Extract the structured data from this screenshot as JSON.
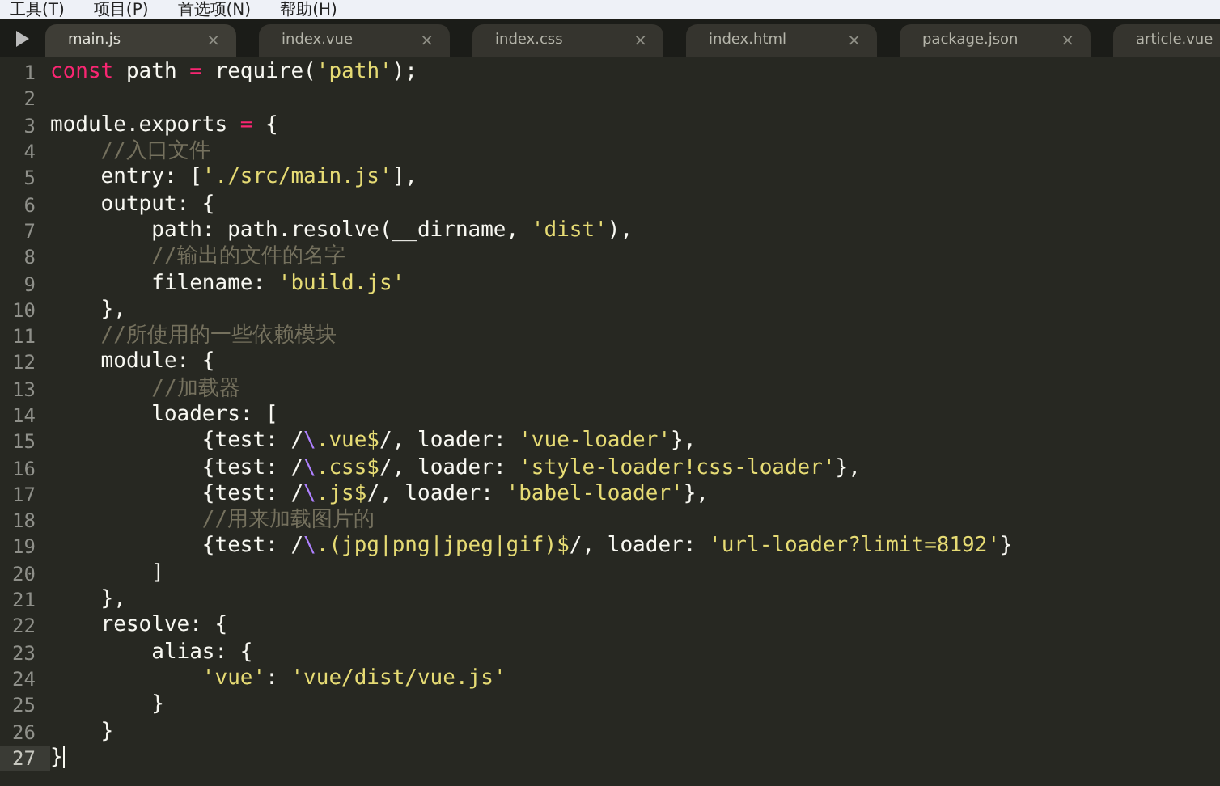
{
  "menu": [
    {
      "label": "工具(T)"
    },
    {
      "label": "项目(P)"
    },
    {
      "label": "首选项(N)"
    },
    {
      "label": "帮助(H)"
    }
  ],
  "tabs": [
    {
      "label": "main.js",
      "selected": true
    },
    {
      "label": "index.vue",
      "selected": false
    },
    {
      "label": "index.css",
      "selected": false
    },
    {
      "label": "index.html",
      "selected": false
    },
    {
      "label": "package.json",
      "selected": false
    },
    {
      "label": "article.vue",
      "selected": false
    }
  ],
  "close_glyph": "×",
  "lines": [
    {
      "number": "1",
      "current": false,
      "segments": [
        {
          "kind": "keyword",
          "text": "const"
        },
        {
          "kind": "plain",
          "text": " path "
        },
        {
          "kind": "keyword",
          "text": "="
        },
        {
          "kind": "plain",
          "text": " require("
        },
        {
          "kind": "string",
          "text": "'path'"
        },
        {
          "kind": "plain",
          "text": ");"
        }
      ]
    },
    {
      "number": "2",
      "current": false
    },
    {
      "number": "3",
      "current": false,
      "segments": [
        {
          "kind": "plain",
          "text": "module.exports "
        },
        {
          "kind": "keyword",
          "text": "="
        },
        {
          "kind": "plain",
          "text": " {"
        }
      ]
    },
    {
      "number": "4",
      "current": false,
      "segments": [
        {
          "kind": "comment",
          "text": "    //入口文件"
        }
      ]
    },
    {
      "number": "5",
      "current": false,
      "segments": [
        {
          "kind": "plain",
          "text": "    entry: ["
        },
        {
          "kind": "string",
          "text": "'./src/main.js'"
        },
        {
          "kind": "plain",
          "text": "],"
        }
      ]
    },
    {
      "number": "6",
      "current": false,
      "segments": [
        {
          "kind": "plain",
          "text": "    output: {"
        }
      ]
    },
    {
      "number": "7",
      "current": false,
      "segments": [
        {
          "kind": "plain",
          "text": "        path: path.resolve(__dirname, "
        },
        {
          "kind": "string",
          "text": "'dist'"
        },
        {
          "kind": "plain",
          "text": "),"
        }
      ]
    },
    {
      "number": "8",
      "current": false,
      "segments": [
        {
          "kind": "comment",
          "text": "        //输出的文件的名字"
        }
      ]
    },
    {
      "number": "9",
      "current": false,
      "segments": [
        {
          "kind": "plain",
          "text": "        filename: "
        },
        {
          "kind": "string",
          "text": "'build.js'"
        }
      ]
    },
    {
      "number": "10",
      "current": false,
      "segments": [
        {
          "kind": "plain",
          "text": "    },"
        }
      ]
    },
    {
      "number": "11",
      "current": false,
      "segments": [
        {
          "kind": "comment",
          "text": "    //所使用的一些依赖模块"
        }
      ]
    },
    {
      "number": "12",
      "current": false,
      "segments": [
        {
          "kind": "plain",
          "text": "    module: {"
        }
      ]
    },
    {
      "number": "13",
      "current": false,
      "segments": [
        {
          "kind": "comment",
          "text": "        //加载器"
        }
      ]
    },
    {
      "number": "14",
      "current": false,
      "segments": [
        {
          "kind": "plain",
          "text": "        loaders: ["
        }
      ]
    },
    {
      "number": "15",
      "current": false,
      "segments": [
        {
          "kind": "plain",
          "text": "            {test: /"
        },
        {
          "kind": "escape",
          "text": "\\"
        },
        {
          "kind": "string",
          "text": ".vue$"
        },
        {
          "kind": "plain",
          "text": "/, loader: "
        },
        {
          "kind": "string",
          "text": "'vue-loader'"
        },
        {
          "kind": "plain",
          "text": "},"
        }
      ]
    },
    {
      "number": "16",
      "current": false,
      "segments": [
        {
          "kind": "plain",
          "text": "            {test: /"
        },
        {
          "kind": "escape",
          "text": "\\"
        },
        {
          "kind": "string",
          "text": ".css$"
        },
        {
          "kind": "plain",
          "text": "/, loader: "
        },
        {
          "kind": "string",
          "text": "'style-loader!css-loader'"
        },
        {
          "kind": "plain",
          "text": "},"
        }
      ]
    },
    {
      "number": "17",
      "current": false,
      "segments": [
        {
          "kind": "plain",
          "text": "            {test: /"
        },
        {
          "kind": "escape",
          "text": "\\"
        },
        {
          "kind": "string",
          "text": ".js$"
        },
        {
          "kind": "plain",
          "text": "/, loader: "
        },
        {
          "kind": "string",
          "text": "'babel-loader'"
        },
        {
          "kind": "plain",
          "text": "},"
        }
      ]
    },
    {
      "number": "18",
      "current": false,
      "segments": [
        {
          "kind": "comment",
          "text": "            //用来加载图片的"
        }
      ]
    },
    {
      "number": "19",
      "current": false,
      "segments": [
        {
          "kind": "plain",
          "text": "            {test: /"
        },
        {
          "kind": "escape",
          "text": "\\"
        },
        {
          "kind": "string",
          "text": ".(jpg|png|jpeg|gif)$"
        },
        {
          "kind": "plain",
          "text": "/, loader: "
        },
        {
          "kind": "string",
          "text": "'url-loader?limit=8192'"
        },
        {
          "kind": "plain",
          "text": "}"
        }
      ]
    },
    {
      "number": "20",
      "current": false,
      "segments": [
        {
          "kind": "plain",
          "text": "        ]"
        }
      ]
    },
    {
      "number": "21",
      "current": false,
      "segments": [
        {
          "kind": "plain",
          "text": "    },"
        }
      ]
    },
    {
      "number": "22",
      "current": false,
      "segments": [
        {
          "kind": "plain",
          "text": "    resolve: {"
        }
      ]
    },
    {
      "number": "23",
      "current": false,
      "segments": [
        {
          "kind": "plain",
          "text": "        alias: {"
        }
      ]
    },
    {
      "number": "24",
      "current": false,
      "segments": [
        {
          "kind": "string",
          "text": "            'vue'"
        },
        {
          "kind": "plain",
          "text": ": "
        },
        {
          "kind": "string",
          "text": "'vue/dist/vue.js'"
        }
      ]
    },
    {
      "number": "25",
      "current": false,
      "segments": [
        {
          "kind": "plain",
          "text": "        }"
        }
      ]
    },
    {
      "number": "26",
      "current": false,
      "segments": [
        {
          "kind": "plain",
          "text": "    }"
        }
      ]
    },
    {
      "number": "27",
      "current": true,
      "segments": [
        {
          "kind": "plain",
          "text": "}"
        }
      ]
    }
  ]
}
